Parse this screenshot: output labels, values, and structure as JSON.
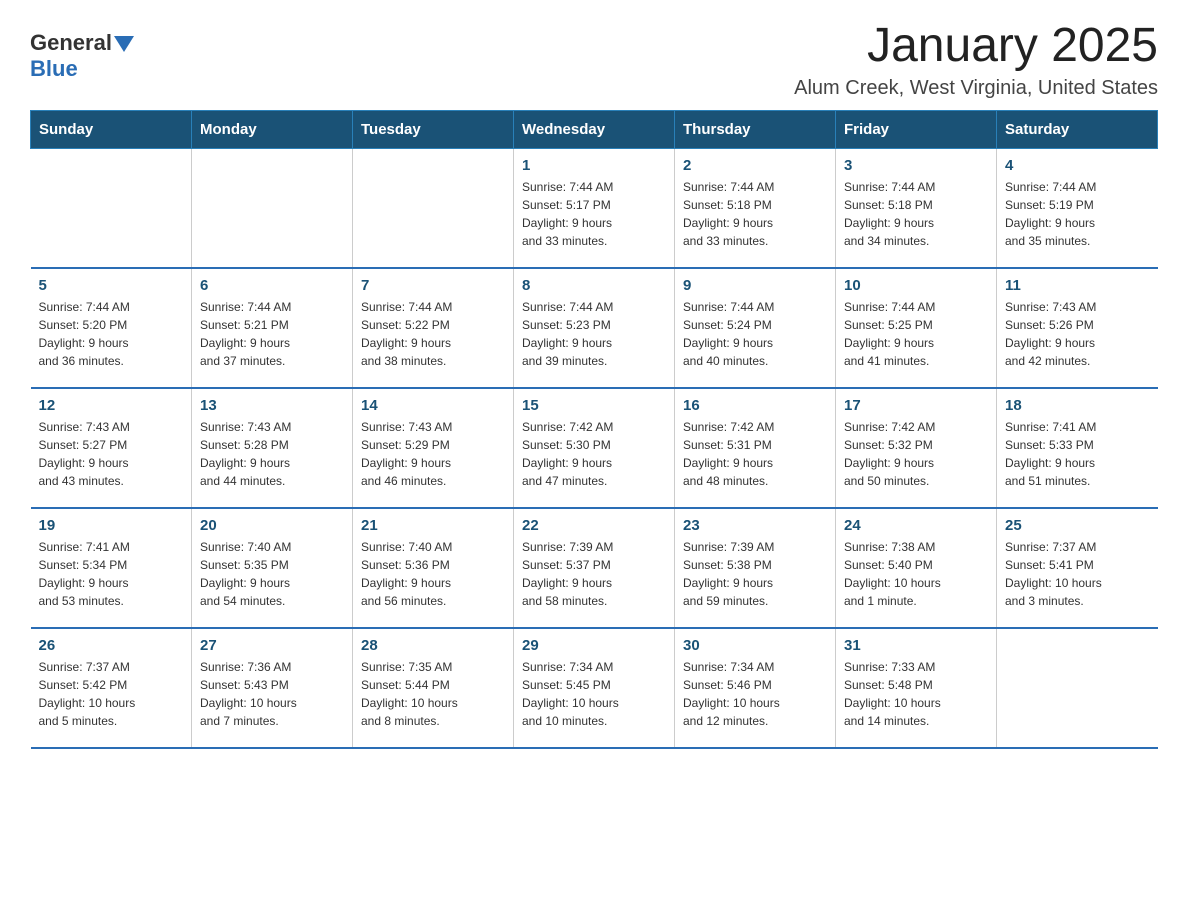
{
  "logo": {
    "general": "General",
    "blue": "Blue"
  },
  "title": "January 2025",
  "subtitle": "Alum Creek, West Virginia, United States",
  "weekdays": [
    "Sunday",
    "Monday",
    "Tuesday",
    "Wednesday",
    "Thursday",
    "Friday",
    "Saturday"
  ],
  "weeks": [
    [
      {
        "day": "",
        "info": ""
      },
      {
        "day": "",
        "info": ""
      },
      {
        "day": "",
        "info": ""
      },
      {
        "day": "1",
        "info": "Sunrise: 7:44 AM\nSunset: 5:17 PM\nDaylight: 9 hours\nand 33 minutes."
      },
      {
        "day": "2",
        "info": "Sunrise: 7:44 AM\nSunset: 5:18 PM\nDaylight: 9 hours\nand 33 minutes."
      },
      {
        "day": "3",
        "info": "Sunrise: 7:44 AM\nSunset: 5:18 PM\nDaylight: 9 hours\nand 34 minutes."
      },
      {
        "day": "4",
        "info": "Sunrise: 7:44 AM\nSunset: 5:19 PM\nDaylight: 9 hours\nand 35 minutes."
      }
    ],
    [
      {
        "day": "5",
        "info": "Sunrise: 7:44 AM\nSunset: 5:20 PM\nDaylight: 9 hours\nand 36 minutes."
      },
      {
        "day": "6",
        "info": "Sunrise: 7:44 AM\nSunset: 5:21 PM\nDaylight: 9 hours\nand 37 minutes."
      },
      {
        "day": "7",
        "info": "Sunrise: 7:44 AM\nSunset: 5:22 PM\nDaylight: 9 hours\nand 38 minutes."
      },
      {
        "day": "8",
        "info": "Sunrise: 7:44 AM\nSunset: 5:23 PM\nDaylight: 9 hours\nand 39 minutes."
      },
      {
        "day": "9",
        "info": "Sunrise: 7:44 AM\nSunset: 5:24 PM\nDaylight: 9 hours\nand 40 minutes."
      },
      {
        "day": "10",
        "info": "Sunrise: 7:44 AM\nSunset: 5:25 PM\nDaylight: 9 hours\nand 41 minutes."
      },
      {
        "day": "11",
        "info": "Sunrise: 7:43 AM\nSunset: 5:26 PM\nDaylight: 9 hours\nand 42 minutes."
      }
    ],
    [
      {
        "day": "12",
        "info": "Sunrise: 7:43 AM\nSunset: 5:27 PM\nDaylight: 9 hours\nand 43 minutes."
      },
      {
        "day": "13",
        "info": "Sunrise: 7:43 AM\nSunset: 5:28 PM\nDaylight: 9 hours\nand 44 minutes."
      },
      {
        "day": "14",
        "info": "Sunrise: 7:43 AM\nSunset: 5:29 PM\nDaylight: 9 hours\nand 46 minutes."
      },
      {
        "day": "15",
        "info": "Sunrise: 7:42 AM\nSunset: 5:30 PM\nDaylight: 9 hours\nand 47 minutes."
      },
      {
        "day": "16",
        "info": "Sunrise: 7:42 AM\nSunset: 5:31 PM\nDaylight: 9 hours\nand 48 minutes."
      },
      {
        "day": "17",
        "info": "Sunrise: 7:42 AM\nSunset: 5:32 PM\nDaylight: 9 hours\nand 50 minutes."
      },
      {
        "day": "18",
        "info": "Sunrise: 7:41 AM\nSunset: 5:33 PM\nDaylight: 9 hours\nand 51 minutes."
      }
    ],
    [
      {
        "day": "19",
        "info": "Sunrise: 7:41 AM\nSunset: 5:34 PM\nDaylight: 9 hours\nand 53 minutes."
      },
      {
        "day": "20",
        "info": "Sunrise: 7:40 AM\nSunset: 5:35 PM\nDaylight: 9 hours\nand 54 minutes."
      },
      {
        "day": "21",
        "info": "Sunrise: 7:40 AM\nSunset: 5:36 PM\nDaylight: 9 hours\nand 56 minutes."
      },
      {
        "day": "22",
        "info": "Sunrise: 7:39 AM\nSunset: 5:37 PM\nDaylight: 9 hours\nand 58 minutes."
      },
      {
        "day": "23",
        "info": "Sunrise: 7:39 AM\nSunset: 5:38 PM\nDaylight: 9 hours\nand 59 minutes."
      },
      {
        "day": "24",
        "info": "Sunrise: 7:38 AM\nSunset: 5:40 PM\nDaylight: 10 hours\nand 1 minute."
      },
      {
        "day": "25",
        "info": "Sunrise: 7:37 AM\nSunset: 5:41 PM\nDaylight: 10 hours\nand 3 minutes."
      }
    ],
    [
      {
        "day": "26",
        "info": "Sunrise: 7:37 AM\nSunset: 5:42 PM\nDaylight: 10 hours\nand 5 minutes."
      },
      {
        "day": "27",
        "info": "Sunrise: 7:36 AM\nSunset: 5:43 PM\nDaylight: 10 hours\nand 7 minutes."
      },
      {
        "day": "28",
        "info": "Sunrise: 7:35 AM\nSunset: 5:44 PM\nDaylight: 10 hours\nand 8 minutes."
      },
      {
        "day": "29",
        "info": "Sunrise: 7:34 AM\nSunset: 5:45 PM\nDaylight: 10 hours\nand 10 minutes."
      },
      {
        "day": "30",
        "info": "Sunrise: 7:34 AM\nSunset: 5:46 PM\nDaylight: 10 hours\nand 12 minutes."
      },
      {
        "day": "31",
        "info": "Sunrise: 7:33 AM\nSunset: 5:48 PM\nDaylight: 10 hours\nand 14 minutes."
      },
      {
        "day": "",
        "info": ""
      }
    ]
  ]
}
